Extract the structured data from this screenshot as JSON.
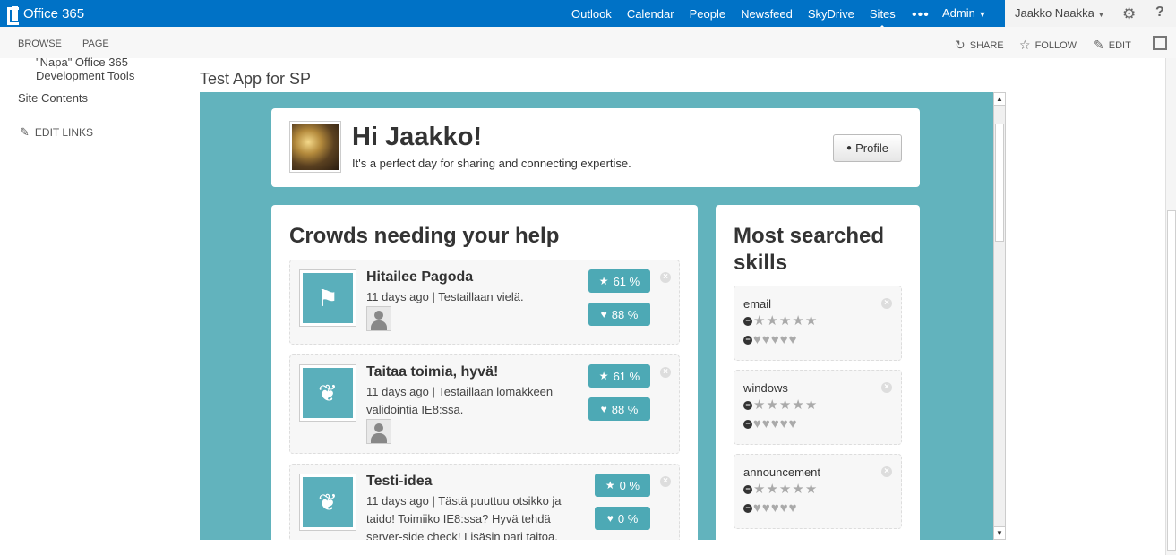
{
  "suitebar": {
    "brand": "Office 365",
    "nav": [
      "Outlook",
      "Calendar",
      "People",
      "Newsfeed",
      "SkyDrive",
      "Sites"
    ],
    "active": "Sites",
    "more": "•••",
    "admin": "Admin",
    "user": "Jaakko Naakka",
    "brand_color": "#0072c6"
  },
  "ribbon": {
    "tabs": [
      "BROWSE",
      "PAGE"
    ],
    "actions": {
      "share": "SHARE",
      "follow": "FOLLOW",
      "edit": "EDIT"
    }
  },
  "leftnav": {
    "item1": "\"Napa\" Office 365 Development Tools",
    "item2": "Site Contents",
    "edit_links": "EDIT LINKS"
  },
  "page": {
    "title": "Test App for SP"
  },
  "app": {
    "greeting": "Hi Jaakko!",
    "subtitle": "It's a perfect day for sharing and connecting expertise.",
    "profile_label": "Profile",
    "crowds_heading": "Crowds needing your help",
    "skills_heading": "Most searched skills",
    "crowds": [
      {
        "title": "Hitailee Pagoda",
        "meta": "11 days ago | Testaillaan vielä.",
        "icon": "flag-icon",
        "star_pct": "61 %",
        "heart_pct": "88 %"
      },
      {
        "title": "Taitaa toimia, hyvä!",
        "meta": "11 days ago | Testaillaan lomakkeen validointia IE8:ssa.",
        "icon": "leaf-icon",
        "star_pct": "61 %",
        "heart_pct": "88 %"
      },
      {
        "title": "Testi-idea",
        "meta": "11 days ago | Tästä puuttuu otsikko ja taido! Toimiiko IE8:ssa? Hyvä tehdä server-side check! Lisäsin pari taitoa.",
        "icon": "leaf-icon",
        "star_pct": "0 %",
        "heart_pct": "0 %"
      }
    ],
    "skills": [
      {
        "name": "email"
      },
      {
        "name": "windows"
      },
      {
        "name": "announcement"
      }
    ],
    "accent_color": "#62b3bd"
  }
}
